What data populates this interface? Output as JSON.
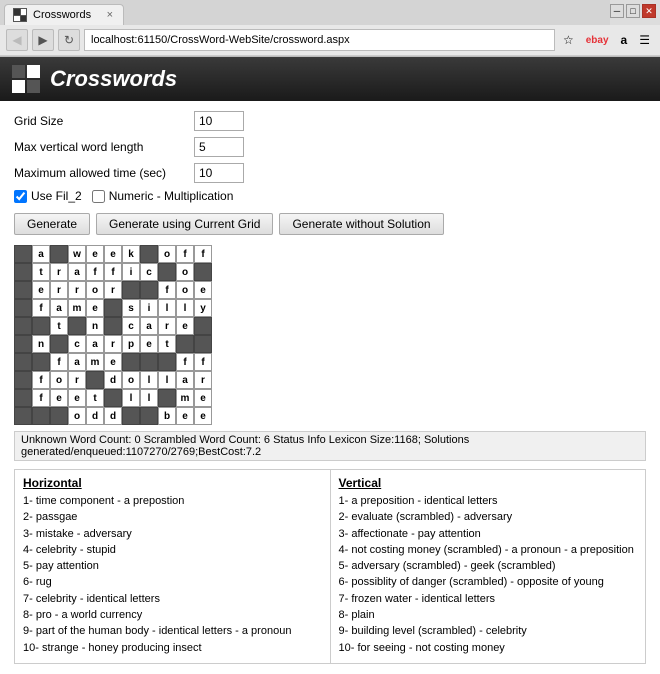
{
  "browser": {
    "tab_title": "Crosswords",
    "tab_close": "×",
    "address": "localhost:61150/CrossWord-WebSite/crossword.aspx",
    "back_btn": "◀",
    "forward_btn": "▶",
    "refresh_btn": "↻",
    "nav_icons": [
      "☆",
      "ebay",
      "a",
      "☰"
    ]
  },
  "app": {
    "title": "Crosswords"
  },
  "form": {
    "grid_size_label": "Grid Size",
    "grid_size_value": "10",
    "max_vert_label": "Max vertical word length",
    "max_vert_value": "5",
    "max_time_label": "Maximum allowed time (sec)",
    "max_time_value": "10",
    "checkbox1_label": "Use Fil_2",
    "checkbox2_label": "Numeric - Multiplication",
    "checkbox1_checked": true,
    "checkbox2_checked": false
  },
  "buttons": {
    "generate": "Generate",
    "generate_current": "Generate using Current Grid",
    "generate_no_solution": "Generate without Solution"
  },
  "status": {
    "text": "Unknown Word Count: 0   Scrambled Word Count: 6   Status Info Lexicon Size:1168; Solutions generated/enqueued:1107270/2769;BestCost:7.2"
  },
  "clues": {
    "horizontal_header": "Horizontal",
    "vertical_header": "Vertical",
    "horizontal": [
      "1- time component - a prepostion",
      "2- passgae",
      "3- mistake - adversary",
      "4- celebrity - stupid",
      "5- pay attention",
      "6- rug",
      "7- celebrity - identical letters",
      "8- pro - a world currency",
      "9- part of the human body - identical letters - a pronoun",
      "10- strange - honey producing insect"
    ],
    "vertical": [
      "1- a preposition - identical letters",
      "2- evaluate (scrambled) - adversary",
      "3- affectionate - pay attention",
      "4- not costing money (scrambled) - a pronoun - a preposition",
      "5- adversary (scrambled) - geek (scrambled)",
      "6- possiblity of danger (scrambled) - opposite of young",
      "7- frozen water - identical letters",
      "8- plain",
      "9- building level (scrambled) - celebrity",
      "10- for seeing - not costing money"
    ]
  },
  "grid": [
    [
      "",
      "a",
      "",
      "w",
      "e",
      "e",
      "k",
      "",
      "o",
      "f",
      "f"
    ],
    [
      "",
      "t",
      "r",
      "a",
      "f",
      "f",
      "i",
      "c",
      "",
      "o",
      ""
    ],
    [
      "",
      "e",
      "r",
      "r",
      "o",
      "r",
      "",
      "",
      "f",
      "o",
      "e"
    ],
    [
      "",
      "f",
      "a",
      "m",
      "e",
      "",
      "s",
      "i",
      "l",
      "l",
      "y"
    ],
    [
      "",
      "",
      "t",
      "",
      "n",
      "",
      "c",
      "a",
      "r",
      "e",
      ""
    ],
    [
      "",
      "n",
      "",
      "c",
      "a",
      "r",
      "p",
      "e",
      "t",
      "",
      ""
    ],
    [
      "",
      "",
      "f",
      "a",
      "m",
      "e",
      "",
      "",
      "",
      "f",
      "f"
    ],
    [
      "",
      "f",
      "o",
      "r",
      "",
      "d",
      "o",
      "l",
      "l",
      "a",
      "r"
    ],
    [
      "",
      "f",
      "e",
      "e",
      "t",
      "",
      "l",
      "l",
      "",
      "m",
      "e"
    ],
    [
      "",
      "",
      "",
      "o",
      "d",
      "d",
      "",
      "",
      "b",
      "e",
      "e"
    ]
  ]
}
